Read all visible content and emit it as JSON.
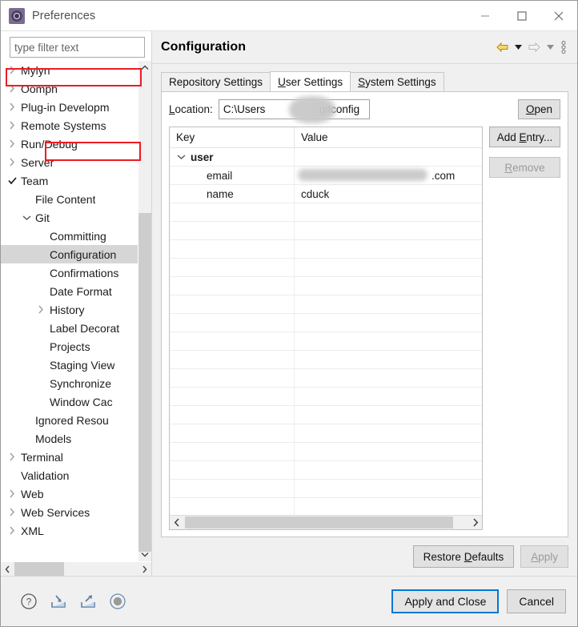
{
  "window": {
    "title": "Preferences",
    "icon": "preferences-gear-icon",
    "controls": {
      "minimize": "minimize-icon",
      "maximize": "maximize-icon",
      "close": "close-icon"
    }
  },
  "filter": {
    "placeholder": "type filter text",
    "value": ""
  },
  "tree": {
    "items": [
      {
        "label": "Mylyn",
        "indent": 0,
        "twisty": "collapsed",
        "selected": false
      },
      {
        "label": "Oomph",
        "indent": 0,
        "twisty": "collapsed",
        "selected": false
      },
      {
        "label": "Plug-in Developm",
        "indent": 0,
        "twisty": "collapsed",
        "selected": false
      },
      {
        "label": "Remote Systems",
        "indent": 0,
        "twisty": "collapsed",
        "selected": false
      },
      {
        "label": "Run/Debug",
        "indent": 0,
        "twisty": "collapsed",
        "selected": false
      },
      {
        "label": "Server",
        "indent": 0,
        "twisty": "collapsed",
        "selected": false
      },
      {
        "label": "Team",
        "indent": 0,
        "twisty": "check",
        "selected": false,
        "highlighted": true
      },
      {
        "label": "File Content",
        "indent": 1,
        "twisty": "none",
        "selected": false
      },
      {
        "label": "Git",
        "indent": 1,
        "twisty": "expanded",
        "selected": false
      },
      {
        "label": "Committing",
        "indent": 2,
        "twisty": "none",
        "selected": false
      },
      {
        "label": "Configuration",
        "indent": 2,
        "twisty": "none",
        "selected": true,
        "highlighted": true
      },
      {
        "label": "Confirmations",
        "indent": 2,
        "twisty": "none",
        "selected": false
      },
      {
        "label": "Date Format",
        "indent": 2,
        "twisty": "none",
        "selected": false
      },
      {
        "label": "History",
        "indent": 2,
        "twisty": "collapsed",
        "selected": false
      },
      {
        "label": "Label Decorat",
        "indent": 2,
        "twisty": "none",
        "selected": false
      },
      {
        "label": "Projects",
        "indent": 2,
        "twisty": "none",
        "selected": false
      },
      {
        "label": "Staging View",
        "indent": 2,
        "twisty": "none",
        "selected": false
      },
      {
        "label": "Synchronize",
        "indent": 2,
        "twisty": "none",
        "selected": false
      },
      {
        "label": "Window Cac",
        "indent": 2,
        "twisty": "none",
        "selected": false
      },
      {
        "label": "Ignored Resou",
        "indent": 1,
        "twisty": "none",
        "selected": false
      },
      {
        "label": "Models",
        "indent": 1,
        "twisty": "none",
        "selected": false
      },
      {
        "label": "Terminal",
        "indent": 0,
        "twisty": "collapsed",
        "selected": false
      },
      {
        "label": "Validation",
        "indent": 0,
        "twisty": "none",
        "selected": false
      },
      {
        "label": "Web",
        "indent": 0,
        "twisty": "collapsed",
        "selected": false
      },
      {
        "label": "Web Services",
        "indent": 0,
        "twisty": "collapsed",
        "selected": false
      },
      {
        "label": "XML",
        "indent": 0,
        "twisty": "collapsed",
        "selected": false
      }
    ],
    "highlight_color": "#ec1c24"
  },
  "page": {
    "title": "Configuration",
    "toolbar": {
      "back": "back-arrow-icon",
      "back_menu": "chevron-down-icon",
      "forward": "forward-arrow-icon",
      "forward_menu": "chevron-down-icon",
      "more": "view-menu-icon"
    },
    "tabs": [
      {
        "label": "Repository Settings",
        "mnemonic": "",
        "active": false
      },
      {
        "label": "User Settings",
        "mnemonic": "U",
        "active": true
      },
      {
        "label": "System Settings",
        "mnemonic": "S",
        "active": false
      }
    ],
    "location": {
      "label": "Location:",
      "value": "C:\\Users                 .gitconfig",
      "value_prefix": "C:\\Users",
      "value_suffix": ".gitconfig",
      "redacted": true,
      "open_button": "Open",
      "open_mnemonic": "O"
    },
    "table": {
      "columns": [
        "Key",
        "Value"
      ],
      "rows": [
        {
          "type": "group",
          "key": "user",
          "value": "",
          "expanded": true
        },
        {
          "type": "entry",
          "key": "email",
          "value": ".com",
          "redacted": true
        },
        {
          "type": "entry",
          "key": "name",
          "value": "cduck",
          "redacted": false
        }
      ],
      "empty_row_count": 17
    },
    "side_buttons": [
      {
        "label": "Add Entry...",
        "mnemonic": "E",
        "enabled": true
      },
      {
        "label": "Remove",
        "mnemonic": "R",
        "enabled": false
      }
    ],
    "footer_buttons": [
      {
        "label": "Restore Defaults",
        "mnemonic": "D",
        "enabled": true
      },
      {
        "label": "Apply",
        "mnemonic": "A",
        "enabled": false
      }
    ]
  },
  "dialog_footer": {
    "icons": [
      {
        "name": "help-icon",
        "glyph": "?"
      },
      {
        "name": "import-icon",
        "glyph": "import"
      },
      {
        "name": "export-icon",
        "glyph": "export"
      },
      {
        "name": "status-icon",
        "glyph": "circle"
      }
    ],
    "buttons": [
      {
        "label": "Apply and Close",
        "default": true
      },
      {
        "label": "Cancel",
        "default": false
      }
    ]
  },
  "colors": {
    "accent": "#0078d7",
    "highlight": "#ec1c24",
    "chrome": "#f0f0f0",
    "selection": "#d6d6d6"
  }
}
